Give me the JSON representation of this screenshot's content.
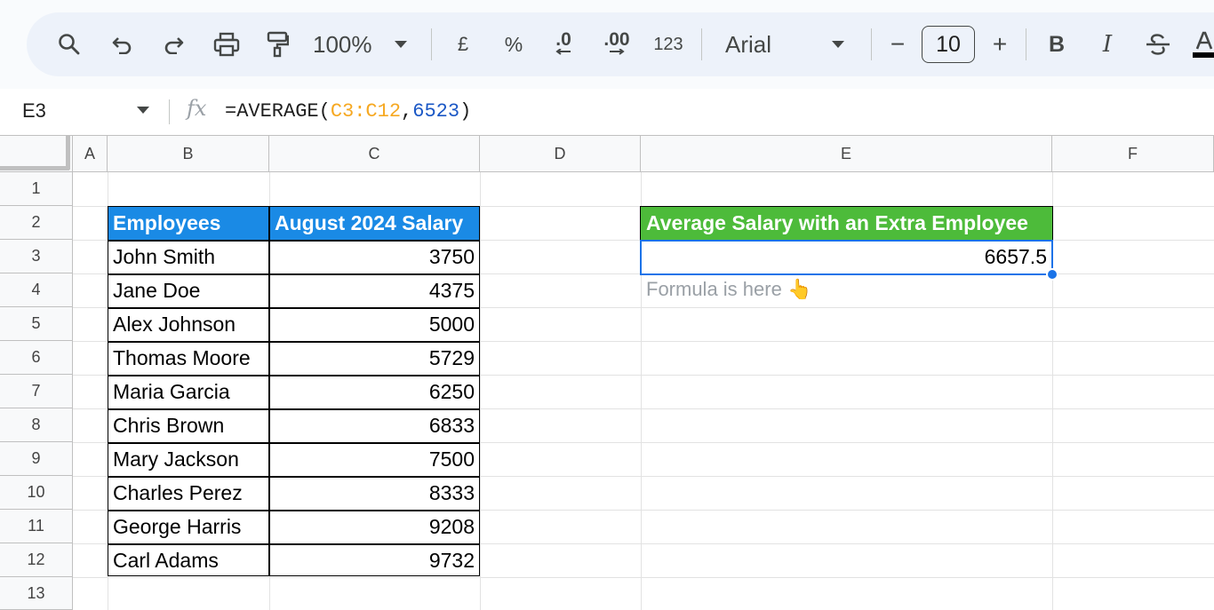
{
  "toolbar": {
    "zoom": "100%",
    "currency": "£",
    "percent": "%",
    "decrease_decimals": ".0",
    "increase_decimals": ".00",
    "number_format": "123",
    "font": "Arial",
    "font_size": "10",
    "minus": "−",
    "plus": "+",
    "bold": "B",
    "italic": "I"
  },
  "formula_bar": {
    "name_box": "E3",
    "fx": "fx",
    "formula_prefix": "=AVERAGE(",
    "formula_range": "C3:C12",
    "formula_comma": ",",
    "formula_num": "6523",
    "formula_suffix": ")"
  },
  "columns": [
    "A",
    "B",
    "C",
    "D",
    "E",
    "F"
  ],
  "rows": [
    "1",
    "2",
    "3",
    "4",
    "5",
    "6",
    "7",
    "8",
    "9",
    "10",
    "11",
    "12",
    "13"
  ],
  "table": {
    "header_employees": "Employees",
    "header_salary": "August 2024 Salary",
    "rows": [
      {
        "name": "John Smith",
        "salary": "3750"
      },
      {
        "name": "Jane Doe",
        "salary": "4375"
      },
      {
        "name": "Alex Johnson",
        "salary": "5000"
      },
      {
        "name": "Thomas Moore",
        "salary": "5729"
      },
      {
        "name": "Maria Garcia",
        "salary": "6250"
      },
      {
        "name": "Chris Brown",
        "salary": "6833"
      },
      {
        "name": "Mary Jackson",
        "salary": "7500"
      },
      {
        "name": "Charles Perez",
        "salary": "8333"
      },
      {
        "name": "George Harris",
        "salary": "9208"
      },
      {
        "name": "Carl Adams",
        "salary": "9732"
      }
    ]
  },
  "result": {
    "header": "Average Salary with an Extra Employee",
    "value": "6657.5",
    "note": "Formula is here 👆"
  },
  "colors": {
    "header_blue": "#1a8ae5",
    "header_green": "#4dbb3a",
    "selection": "#1a73e8",
    "range_color": "#f6a821",
    "number_color": "#1a57c5"
  }
}
